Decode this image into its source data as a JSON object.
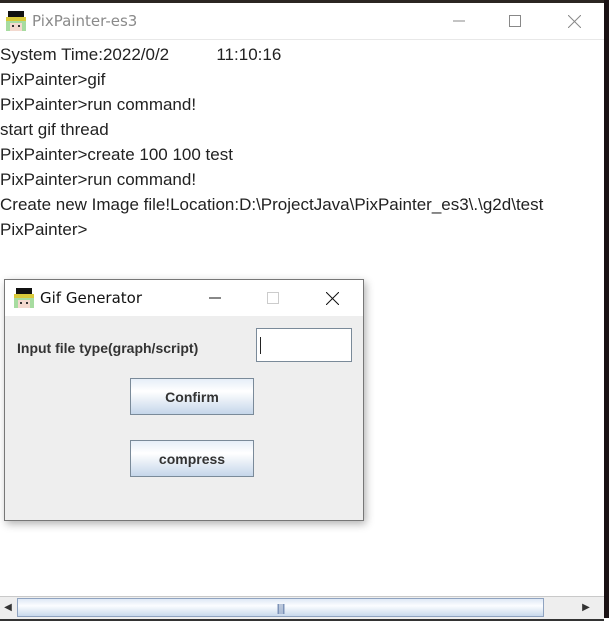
{
  "main_window": {
    "title": "PixPainter-es3",
    "console_lines": [
      "System Time:2022/0/2          11:10:16",
      "PixPainter>gif",
      "PixPainter>run command!",
      "start gif thread",
      "PixPainter>create 100 100 test",
      "PixPainter>run command!",
      "Create new Image file!Location:D:\\ProjectJava\\PixPainter_es3\\.\\g2d\\test",
      "PixPainter>"
    ],
    "controls": {
      "minimize": "minimize-icon",
      "maximize": "maximize-icon",
      "close": "close-icon"
    }
  },
  "dialog": {
    "title": "Gif Generator",
    "input_label": "Input file type(graph/script)",
    "input_value": "",
    "confirm_label": "Confirm",
    "compress_label": "compress"
  },
  "scrollbar": {
    "left_arrow": "◀",
    "right_arrow": "▶"
  }
}
